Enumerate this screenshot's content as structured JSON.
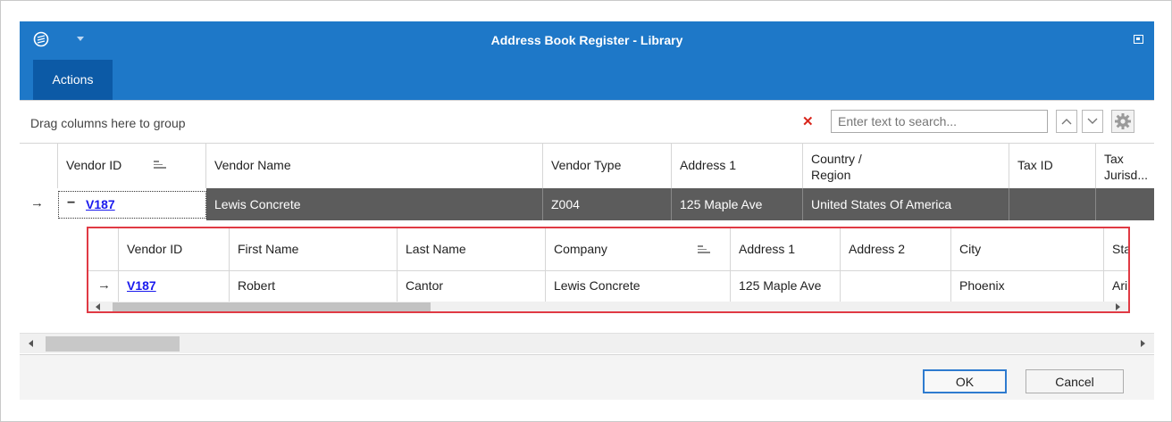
{
  "window": {
    "title": "Address Book Register - Library"
  },
  "ribbon": {
    "active_tab": "Actions"
  },
  "toolbar": {
    "group_hint": "Drag columns here to group",
    "search_placeholder": "Enter text to search..."
  },
  "grid": {
    "columns": [
      "Vendor ID",
      "Vendor Name",
      "Vendor Type",
      "Address 1",
      "Country / Region",
      "Tax ID",
      "Tax Jurisd..."
    ],
    "column_country_line1": "Country /",
    "column_country_line2": "Region",
    "column_tax_line1": "Tax",
    "column_tax_line2": "Jurisd...",
    "row": {
      "vendor_id": "V187",
      "vendor_name": "Lewis Concrete",
      "vendor_type": "Z004",
      "address1": "125 Maple Ave",
      "country": "United States Of America",
      "tax_id": "",
      "tax_jurisdiction": ""
    }
  },
  "detail": {
    "columns": [
      "Vendor ID",
      "First Name",
      "Last Name",
      "Company",
      "Address 1",
      "Address 2",
      "City",
      "Sta"
    ],
    "row": {
      "vendor_id": "V187",
      "first_name": "Robert",
      "last_name": "Cantor",
      "company": "Lewis Concrete",
      "address1": "125 Maple Ave",
      "address2": "",
      "city": "Phoenix",
      "state": "Ari"
    }
  },
  "buttons": {
    "ok": "OK",
    "cancel": "Cancel"
  },
  "colors": {
    "titlebar": "#1e78c8",
    "ribbon_tab": "#0c5aa6",
    "selected_row": "#5c5c5c",
    "detail_border": "#e03a44",
    "link": "#1a1aee"
  },
  "icons": [
    "app-logo-icon",
    "dropdown-arrow-icon",
    "restore-icon",
    "clear-search-icon",
    "chevron-up-icon",
    "chevron-down-icon",
    "gear-icon",
    "sort-icon",
    "row-arrow-icon",
    "collapse-icon"
  ]
}
